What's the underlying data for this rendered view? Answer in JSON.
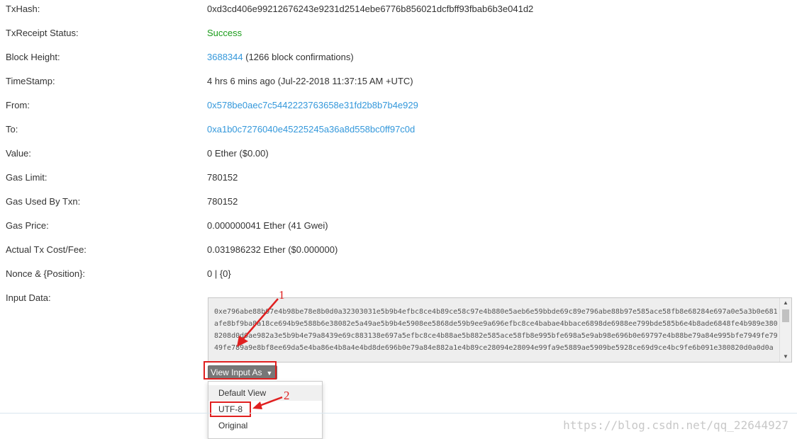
{
  "details": [
    {
      "label": "TxHash:",
      "value": "0xd3cd406e99212676243e9231d2514ebe6776b856021dcfbff93fbab6b3e041d2"
    },
    {
      "label": "TxReceipt Status:",
      "value": "Success"
    },
    {
      "label": "Block Height:",
      "value_link": "3688344",
      "value_suffix": " (1266 block confirmations)"
    },
    {
      "label": "TimeStamp:",
      "value": "4 hrs 6 mins ago (Jul-22-2018 11:37:15 AM +UTC)"
    },
    {
      "label": "From:",
      "value": "0x578be0aec7c5442223763658e31fd2b8b7b4e929"
    },
    {
      "label": "To:",
      "value": "0xa1b0c7276040e45225245a36a8d558bc0ff97c0d"
    },
    {
      "label": "Value:",
      "value": "0 Ether ($0.00)"
    },
    {
      "label": "Gas Limit:",
      "value": "780152"
    },
    {
      "label": "Gas Used By Txn:",
      "value": "780152"
    },
    {
      "label": "Gas Price:",
      "value": "0.000000041 Ether (41 Gwei)"
    },
    {
      "label": "Actual Tx Cost/Fee:",
      "value": "0.031986232 Ether ($0.000000)"
    },
    {
      "label": "Nonce & {Position}:",
      "value": "0 | {0}"
    },
    {
      "label": "Input Data:"
    }
  ],
  "input_data": {
    "text": "0xe796abe88b97e4b98be78e8b0d0a32303031e5b9b4efbc8ce4b89ce58c97e4b880e5aeb6e59bbde69c89e796abe88b97e585ace58fb8e68284e697a0e5a3b0e681afe8bf9ba8a18ce694b9e588b6e38082e5a49ae5b9b4e5908ee5868de59b9ee9a696efbc8ce4babae4bbace6898de6988ee799bde585b6e4b8ade6848fe4b989e3808208d0d0ae982a3e5b9b4e79a8439e69c883138e697a5efbc8ce4b88ae5b882e585ace58fb8e995bfe698a5e9ab98e696b0e69797e4b88be79a84e995bfe7949fe7949fe789a9e8bf8ee69da5e4ba86e4b8a4e4bd8de696b0e79a84e882a1e4b89ce28094e28094e99fa9e5889ae5909be5928ce69d9ce4bc9fe6b091e380820d0a0d0a"
  },
  "view_input_button": {
    "label": "View Input As"
  },
  "view_menu": {
    "items": [
      "Default View",
      "UTF-8",
      "Original"
    ]
  },
  "annotations": {
    "marker_1": "1",
    "marker_2": "2",
    "color": "#e02020"
  },
  "watermark": "https://blog.csdn.net/qq_22644927",
  "colors": {
    "link": "#3498db",
    "success": "#1a9c1a",
    "button_bg": "#777777"
  }
}
